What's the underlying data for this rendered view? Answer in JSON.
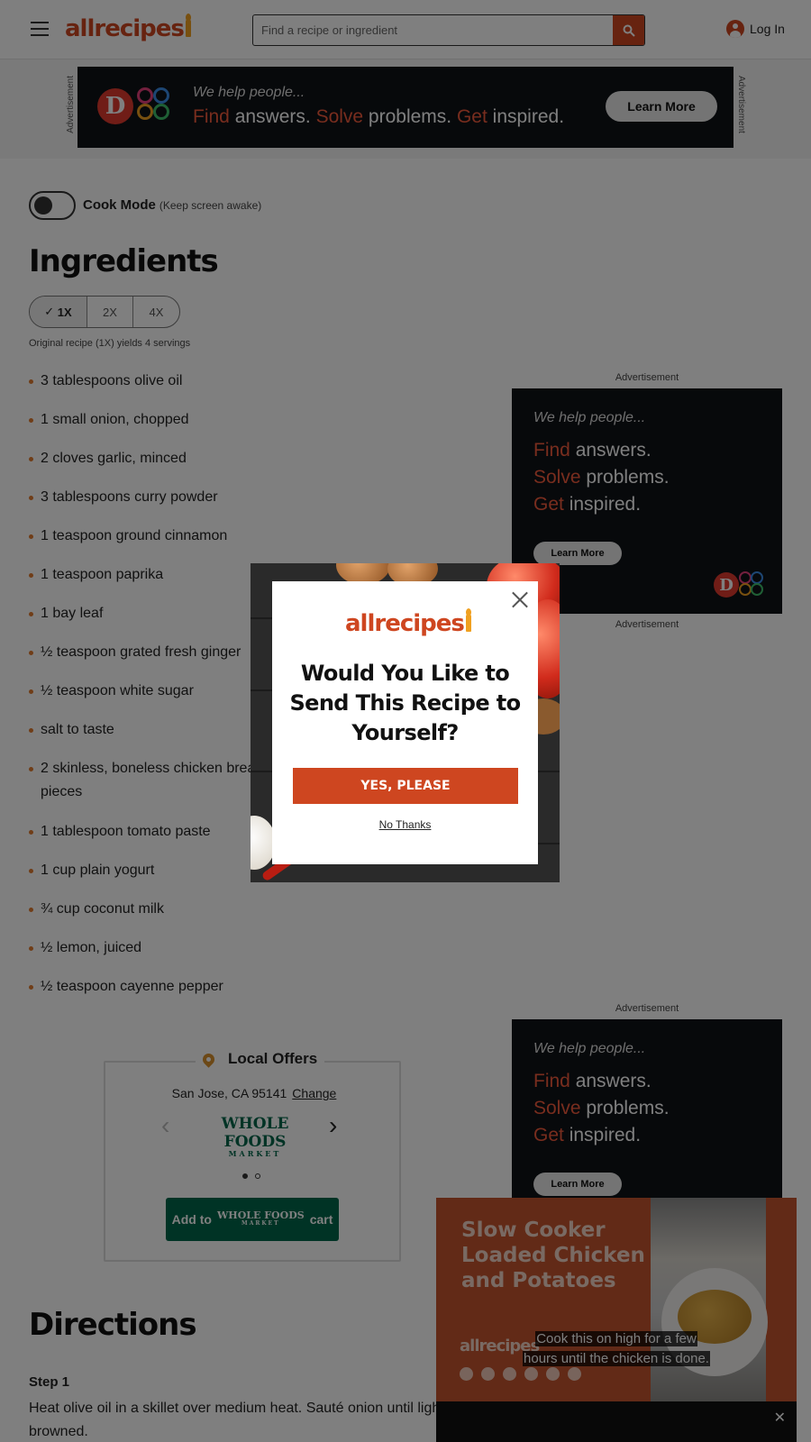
{
  "header": {
    "logo": "allrecipes",
    "search_placeholder": "Find a recipe or ingredient",
    "login_label": "Log In"
  },
  "top_ad": {
    "label": "Advertisement",
    "tagline_small": "We help people...",
    "find": "Find",
    "answers": " answers. ",
    "solve": "Solve",
    "problems": " problems. ",
    "get": "Get",
    "inspired": " inspired.",
    "cta": "Learn More"
  },
  "cook_mode": {
    "label": "Cook Mode",
    "sub": "(Keep screen awake)"
  },
  "ingredients": {
    "heading": "Ingredients",
    "scales": [
      "1X",
      "2X",
      "4X"
    ],
    "active_scale": "1X",
    "yields": "Original recipe (1X) yields 4 servings",
    "items": [
      "3 tablespoons olive oil",
      "1 small onion, chopped",
      "2 cloves garlic, minced",
      "3 tablespoons curry powder",
      "1 teaspoon ground cinnamon",
      "1 teaspoon paprika",
      "1 bay leaf",
      "½ teaspoon grated fresh ginger",
      "½ teaspoon white sugar",
      "salt to taste",
      "2 skinless, boneless chicken breast halves - cut into bite-size pieces",
      "1 tablespoon tomato paste",
      "1 cup plain yogurt",
      "¾ cup coconut milk",
      "½ lemon, juiced",
      "½ teaspoon cayenne pepper"
    ]
  },
  "side_ads": {
    "label": "Advertisement",
    "tagline_small": "We help people...",
    "find": "Find",
    "answers": " answers.",
    "solve": "Solve",
    "problems": " problems.",
    "get": "Get",
    "inspired": " inspired.",
    "cta": "Learn More"
  },
  "local_offers": {
    "title": "Local Offers",
    "location": "San Jose, CA 95141",
    "change": "Change",
    "store": "WHOLE FOODS",
    "store_sub": "MARKET",
    "button_prefix": "Add to",
    "button_suffix": "cart"
  },
  "directions": {
    "heading": "Directions",
    "step_label": "Step 1",
    "step_text": "Heat olive oil in a skillet over medium heat. Sauté onion until lightly browned."
  },
  "video": {
    "title": "Slow Cooker Loaded Chicken and Potatoes",
    "brand": "allrecipes",
    "caption_line1": "Cook this on high for a few",
    "caption_line2": "hours until the chicken is done."
  },
  "modal": {
    "logo": "allrecipes",
    "title": "Would You Like to Send This Recipe to Yourself?",
    "yes": "YES, PLEASE",
    "no": "No Thanks"
  },
  "colors": {
    "brand": "#ce4620",
    "wholefoods": "#00674b",
    "bullet": "#e07b2f"
  }
}
